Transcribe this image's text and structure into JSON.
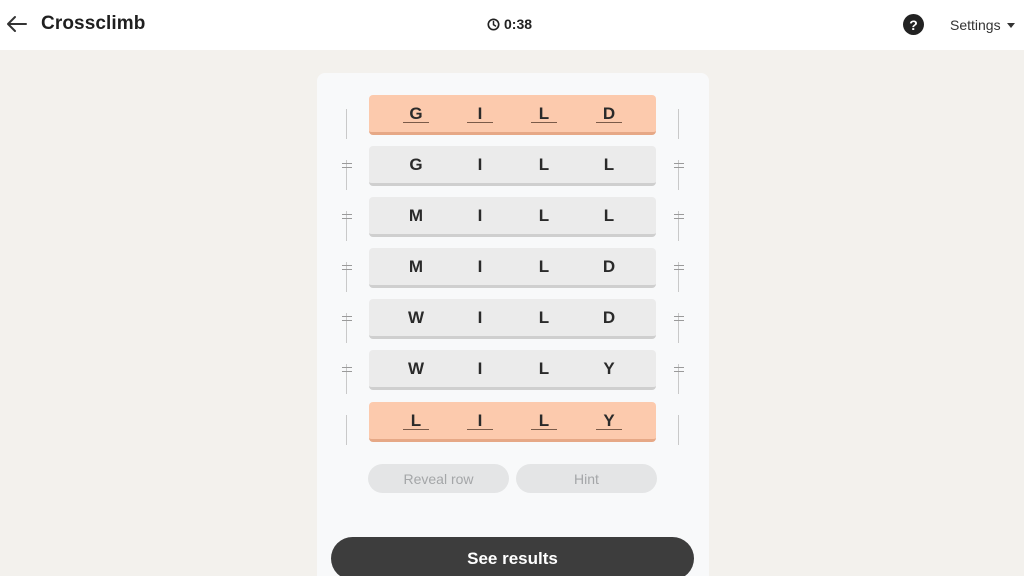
{
  "header": {
    "title": "Crossclimb",
    "timer": "0:38",
    "help_label": "?",
    "settings_label": "Settings"
  },
  "rows": [
    {
      "letters": [
        "G",
        "I",
        "L",
        "D"
      ],
      "locked": true
    },
    {
      "letters": [
        "G",
        "I",
        "L",
        "L"
      ],
      "locked": false
    },
    {
      "letters": [
        "M",
        "I",
        "L",
        "L"
      ],
      "locked": false
    },
    {
      "letters": [
        "M",
        "I",
        "L",
        "D"
      ],
      "locked": false
    },
    {
      "letters": [
        "W",
        "I",
        "L",
        "D"
      ],
      "locked": false
    },
    {
      "letters": [
        "W",
        "I",
        "L",
        "Y"
      ],
      "locked": false
    },
    {
      "letters": [
        "L",
        "I",
        "L",
        "Y"
      ],
      "locked": true
    }
  ],
  "actions": {
    "reveal_row_label": "Reveal row",
    "hint_label": "Hint",
    "see_results_label": "See results"
  },
  "colors": {
    "locked_row": "#fccaad",
    "row": "#ebebeb",
    "cta": "#3d3d3d"
  }
}
